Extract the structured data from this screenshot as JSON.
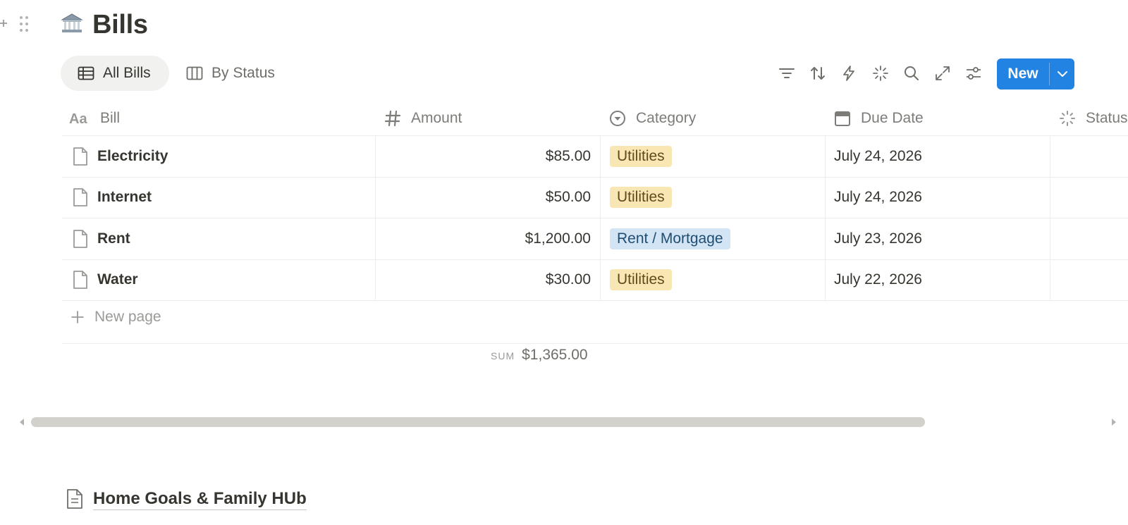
{
  "page": {
    "title": "Bills",
    "title_icon": "bank-building-icon"
  },
  "views": {
    "tabs": [
      {
        "label": "All Bills",
        "icon": "table-icon",
        "active": true
      },
      {
        "label": "By Status",
        "icon": "board-icon",
        "active": false
      }
    ]
  },
  "toolbar": {
    "icons": [
      "filter-icon",
      "sort-icon",
      "automation-icon",
      "ai-sparkle-icon",
      "search-icon",
      "expand-icon",
      "settings-sliders-icon"
    ],
    "new_label": "New"
  },
  "table": {
    "columns": [
      {
        "label": "Bill",
        "icon": "title-aa-icon"
      },
      {
        "label": "Amount",
        "icon": "number-hash-icon"
      },
      {
        "label": "Category",
        "icon": "select-icon"
      },
      {
        "label": "Due Date",
        "icon": "calendar-icon"
      },
      {
        "label": "Status",
        "icon": "status-icon"
      }
    ],
    "rows": [
      {
        "bill": "Electricity",
        "amount": "$85.00",
        "category": "Utilities",
        "category_color": "#f9e7b3",
        "due": "July 24, 2026"
      },
      {
        "bill": "Internet",
        "amount": "$50.00",
        "category": "Utilities",
        "category_color": "#f9e7b3",
        "due": "July 24, 2026"
      },
      {
        "bill": "Rent",
        "amount": "$1,200.00",
        "category": "Rent / Mortgage",
        "category_color": "#d3e5f4",
        "due": "July 23, 2026"
      },
      {
        "bill": "Water",
        "amount": "$30.00",
        "category": "Utilities",
        "category_color": "#f9e7b3",
        "due": "July 22, 2026"
      }
    ],
    "new_page_label": "New page",
    "sum_key": "SUM",
    "sum_value": "$1,365.00"
  },
  "linked_page": {
    "title": "Home Goals & Family HUb"
  },
  "colors": {
    "accent": "#2383e2",
    "tag_yellow": "#f9e7b3",
    "tag_blue": "#d3e5f4"
  }
}
